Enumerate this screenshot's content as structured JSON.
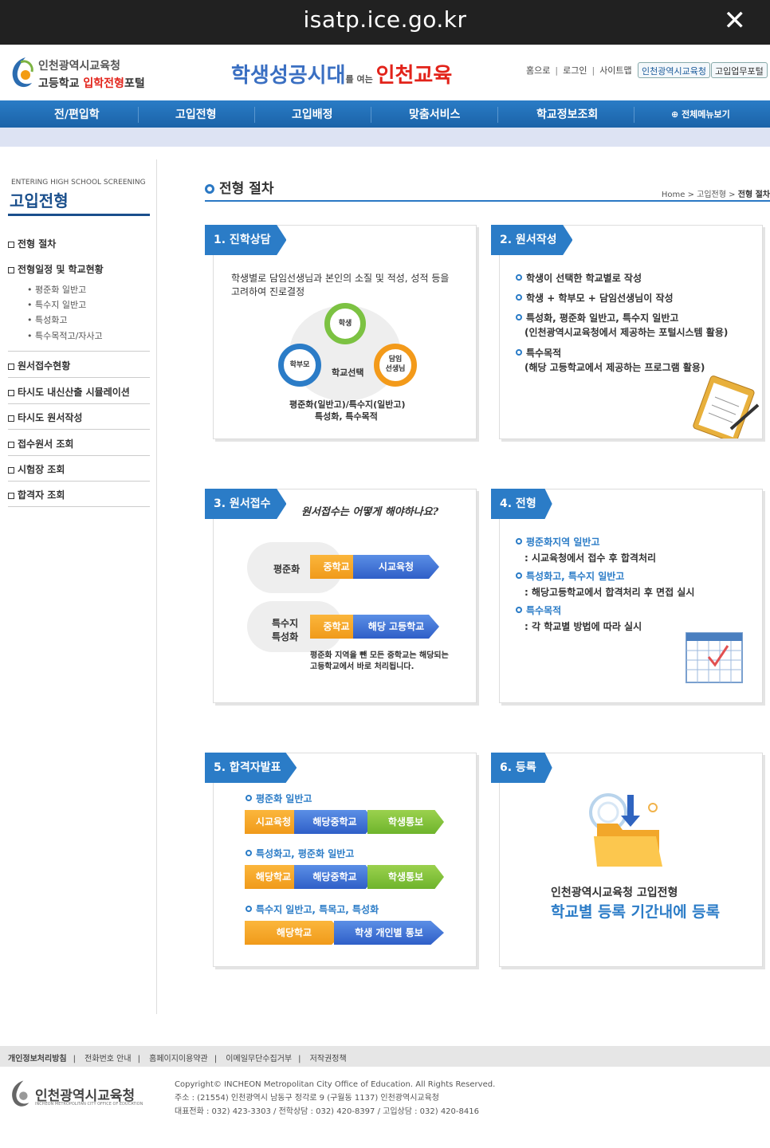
{
  "browser": {
    "url": "isatp.ice.go.kr"
  },
  "header": {
    "logo_line1": "인천광역시교육청",
    "logo_line2a": "고등학교 ",
    "logo_line2b": "입학전형",
    "logo_line2c": "포털",
    "slogan_a": "학생성공시대",
    "slogan_b": "를 여는 ",
    "slogan_c": "인천교육",
    "links": [
      "홈으로",
      "로그인",
      "사이트맵"
    ],
    "btn_office": "인천광역시교육청",
    "btn_portal": "고입업무포털"
  },
  "nav": {
    "items": [
      "전/편입학",
      "고입전형",
      "고입배정",
      "맞춤서비스",
      "학교정보조회"
    ],
    "all_menu": "전체메뉴보기"
  },
  "sidebar": {
    "entering": "ENTERING HIGH SCHOOL SCREENING",
    "title": "고입전형",
    "menu": [
      "전형 절차",
      "전형일정 및 학교현황",
      "원서접수현황",
      "타시도 내신산출 시뮬레이션",
      "타시도 원서작성",
      "접수원서 조회",
      "시험장 조회",
      "합격자 조회"
    ],
    "sub": [
      "평준화 일반고",
      "특수지 일반고",
      "특성화고",
      "특수목적고/자사고"
    ]
  },
  "main": {
    "title": "전형 절차",
    "crumb_home": "Home",
    "crumb_mid": "고입전형",
    "crumb_cur": "전형 절차"
  },
  "cards": {
    "c1": {
      "label": "1. 진학상담",
      "text1": "학생별로 담임선생님과 본인의 소질 및 적성, 성적 등을",
      "text2": "고려하여 진로결정",
      "student": "학생",
      "parent": "학부모",
      "teacher1": "담임",
      "teacher2": "선생님",
      "center": "학교선택",
      "cap1": "평준화(일반고)/특수지(일반고)",
      "cap2": "특성화, 특수목적"
    },
    "c2": {
      "label": "2. 원서작성",
      "b1": "학생이 선택한 학교별로 작성",
      "b2": "학생 + 학부모 + 담임선생님이 작성",
      "b3": "특성화, 평준화 일반고, 특수지 일반고",
      "b3s": "(인천광역시교육청에서 제공하는 포털시스템 활용)",
      "b4": "특수목적",
      "b4s": "(해당 고등학교에서 제공하는 프로그램 활용)"
    },
    "c3": {
      "label": "3. 원서접수",
      "question": "원서접수는 어떻게 해야하나요?",
      "row1": "평준화",
      "row2a": "특수지",
      "row2b": "특성화",
      "p_middle": "중학교",
      "p_office": "시교육청",
      "p_high": "해당 고등학교",
      "note1": "평준화 지역을 뺀 모든 중학교는 해당되는",
      "note2": "고등학교에서 바로 처리됩니다."
    },
    "c4": {
      "label": "4. 전형",
      "h1": "평준화지역 일반고",
      "d1": ": 시교육청에서 접수 후 합격처리",
      "h2": "특성화고, 특수지 일반고",
      "d2": ": 해당고등학교에서 합격처리 후 면접 실시",
      "h3": "특수목적",
      "d3": ": 각 학교별 방법에 따라 실시"
    },
    "c5": {
      "label": "5. 합격자발표",
      "h1": "평준화 일반고",
      "h2": "특성화고, 평준화 일반고",
      "h3": "특수지 일반고, 특목고, 특성화",
      "r1": [
        "시교육청",
        "해당중학교",
        "학생통보"
      ],
      "r2": [
        "해당학교",
        "해당중학교",
        "학생통보"
      ],
      "r3": [
        "해당학교",
        "학생 개인별 통보"
      ]
    },
    "c6": {
      "label": "6. 등록",
      "line1": "인천광역시교육청 고입전형",
      "line2": "학교별 등록 기간내에 등록"
    }
  },
  "footer": {
    "links": [
      "개인정보처리방침",
      "전화번호 안내",
      "홈페이지이용약관",
      "이메일무단수집거부",
      "저작권정책"
    ],
    "logo": "인천광역시교육청",
    "logo_en": "INCHEON METROPOLITAN CITY OFFICE OF EDUCATION",
    "copyright": "Copyright© INCHEON Metropolitan City Office of Education. All Rights Reserved.",
    "address": "주소 : (21554) 인천광역시 남동구 정각로 9 (구월동 1137) 인천광역시교육청",
    "phone": "대표전화 : 032) 423-3303 / 전학상담 : 032) 420-8397 / 고입상담 : 032) 420-8416"
  }
}
